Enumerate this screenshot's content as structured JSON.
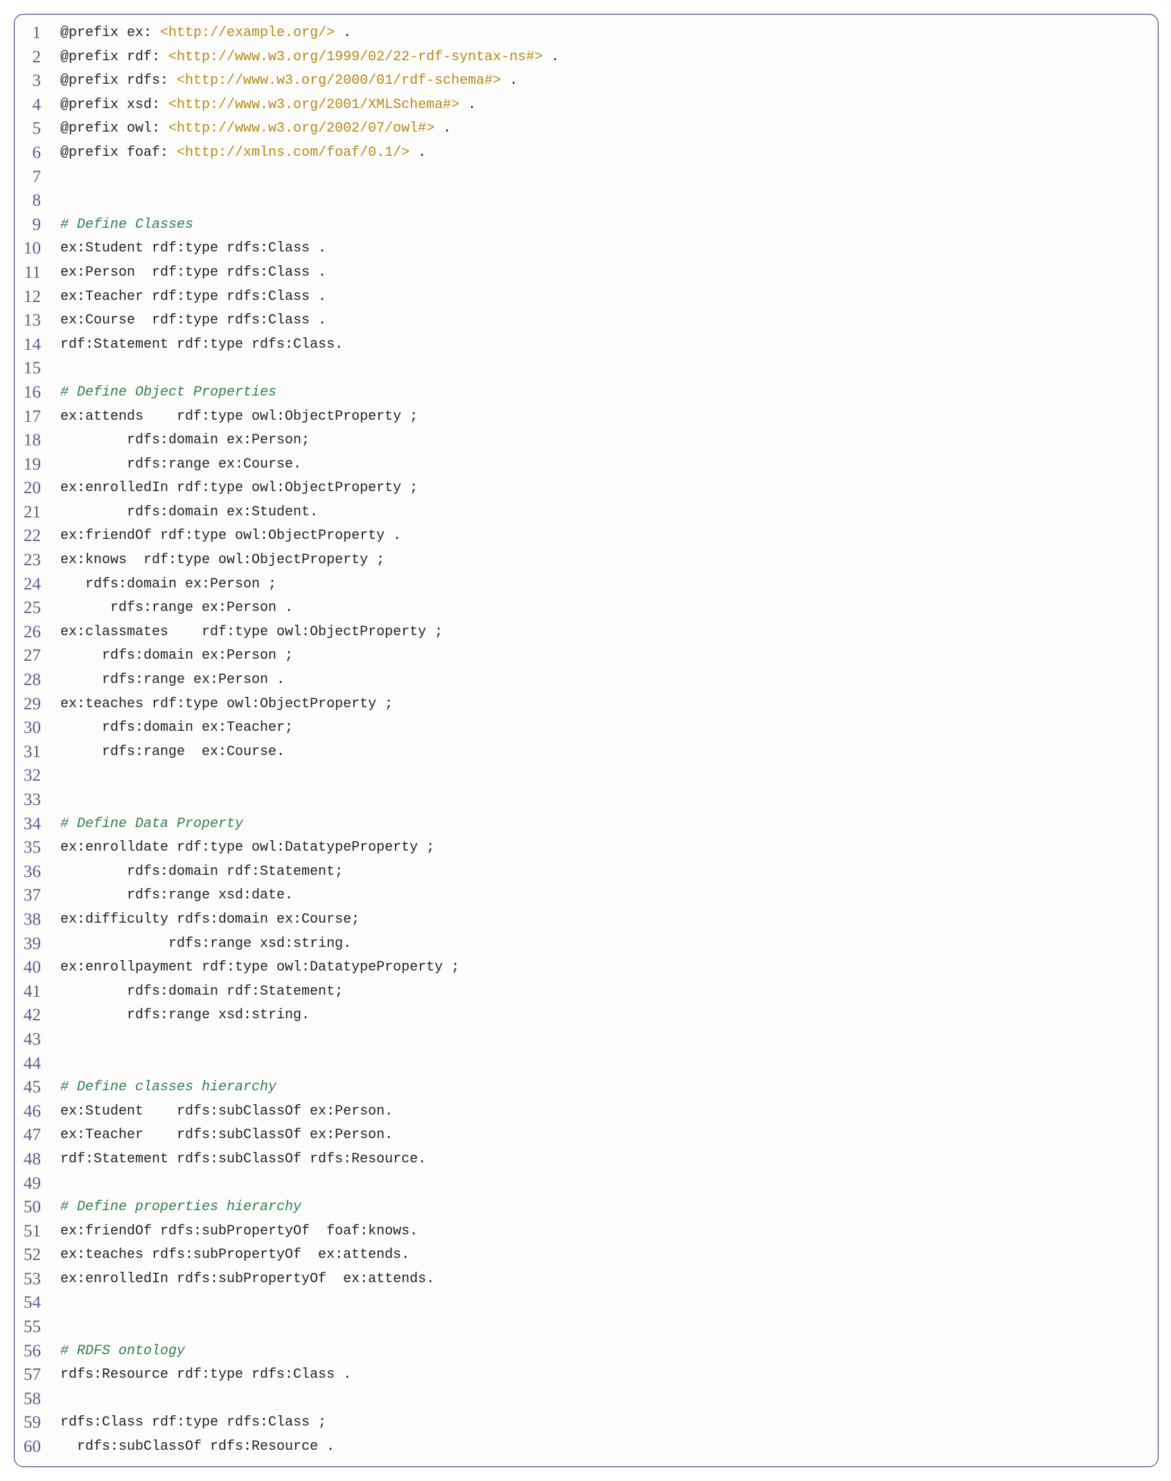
{
  "lines": [
    {
      "num": 1,
      "segs": [
        {
          "t": "@prefix ex: "
        },
        {
          "t": "<http://example.org/>",
          "c": "str"
        },
        {
          "t": " ."
        }
      ]
    },
    {
      "num": 2,
      "segs": [
        {
          "t": "@prefix rdf: "
        },
        {
          "t": "<http://www.w3.org/1999/02/22-rdf-syntax-ns#>",
          "c": "str"
        },
        {
          "t": " ."
        }
      ]
    },
    {
      "num": 3,
      "segs": [
        {
          "t": "@prefix rdfs: "
        },
        {
          "t": "<http://www.w3.org/2000/01/rdf-schema#>",
          "c": "str"
        },
        {
          "t": " ."
        }
      ]
    },
    {
      "num": 4,
      "segs": [
        {
          "t": "@prefix xsd: "
        },
        {
          "t": "<http://www.w3.org/2001/XMLSchema#>",
          "c": "str"
        },
        {
          "t": " ."
        }
      ]
    },
    {
      "num": 5,
      "segs": [
        {
          "t": "@prefix owl: "
        },
        {
          "t": "<http://www.w3.org/2002/07/owl#>",
          "c": "str"
        },
        {
          "t": " ."
        }
      ]
    },
    {
      "num": 6,
      "segs": [
        {
          "t": "@prefix foaf: "
        },
        {
          "t": "<http://xmlns.com/foaf/0.1/>",
          "c": "str"
        },
        {
          "t": " ."
        }
      ]
    },
    {
      "num": 7,
      "segs": [
        {
          "t": ""
        }
      ]
    },
    {
      "num": 8,
      "segs": [
        {
          "t": ""
        }
      ]
    },
    {
      "num": 9,
      "segs": [
        {
          "t": "# Define Classes",
          "c": "com"
        }
      ]
    },
    {
      "num": 10,
      "segs": [
        {
          "t": "ex:Student rdf:type rdfs:Class ."
        }
      ]
    },
    {
      "num": 11,
      "segs": [
        {
          "t": "ex:Person  rdf:type rdfs:Class ."
        }
      ]
    },
    {
      "num": 12,
      "segs": [
        {
          "t": "ex:Teacher rdf:type rdfs:Class ."
        }
      ]
    },
    {
      "num": 13,
      "segs": [
        {
          "t": "ex:Course  rdf:type rdfs:Class ."
        }
      ]
    },
    {
      "num": 14,
      "segs": [
        {
          "t": "rdf:Statement rdf:type rdfs:Class."
        }
      ]
    },
    {
      "num": 15,
      "segs": [
        {
          "t": ""
        }
      ]
    },
    {
      "num": 16,
      "segs": [
        {
          "t": "# Define Object Properties",
          "c": "com"
        }
      ]
    },
    {
      "num": 17,
      "segs": [
        {
          "t": "ex:attends    rdf:type owl:ObjectProperty ;"
        }
      ]
    },
    {
      "num": 18,
      "segs": [
        {
          "t": "        rdfs:domain ex:Person;"
        }
      ]
    },
    {
      "num": 19,
      "segs": [
        {
          "t": "        rdfs:range ex:Course."
        }
      ]
    },
    {
      "num": 20,
      "segs": [
        {
          "t": "ex:enrolledIn rdf:type owl:ObjectProperty ;"
        }
      ]
    },
    {
      "num": 21,
      "segs": [
        {
          "t": "        rdfs:domain ex:Student."
        }
      ]
    },
    {
      "num": 22,
      "segs": [
        {
          "t": "ex:friendOf rdf:type owl:ObjectProperty ."
        }
      ]
    },
    {
      "num": 23,
      "segs": [
        {
          "t": "ex:knows  rdf:type owl:ObjectProperty ;"
        }
      ]
    },
    {
      "num": 24,
      "segs": [
        {
          "t": "   rdfs:domain ex:Person ;"
        }
      ]
    },
    {
      "num": 25,
      "segs": [
        {
          "t": "      rdfs:range ex:Person ."
        }
      ]
    },
    {
      "num": 26,
      "segs": [
        {
          "t": "ex:classmates    rdf:type owl:ObjectProperty ;"
        }
      ]
    },
    {
      "num": 27,
      "segs": [
        {
          "t": "     rdfs:domain ex:Person ;"
        }
      ]
    },
    {
      "num": 28,
      "segs": [
        {
          "t": "     rdfs:range ex:Person ."
        }
      ]
    },
    {
      "num": 29,
      "segs": [
        {
          "t": "ex:teaches rdf:type owl:ObjectProperty ;"
        }
      ]
    },
    {
      "num": 30,
      "segs": [
        {
          "t": "     rdfs:domain ex:Teacher;"
        }
      ]
    },
    {
      "num": 31,
      "segs": [
        {
          "t": "     rdfs:range  ex:Course."
        }
      ]
    },
    {
      "num": 32,
      "segs": [
        {
          "t": ""
        }
      ]
    },
    {
      "num": 33,
      "segs": [
        {
          "t": ""
        }
      ]
    },
    {
      "num": 34,
      "segs": [
        {
          "t": "# Define Data Property",
          "c": "com"
        }
      ]
    },
    {
      "num": 35,
      "segs": [
        {
          "t": "ex:enrolldate rdf:type owl:DatatypeProperty ;"
        }
      ]
    },
    {
      "num": 36,
      "segs": [
        {
          "t": "        rdfs:domain rdf:Statement;"
        }
      ]
    },
    {
      "num": 37,
      "segs": [
        {
          "t": "        rdfs:range xsd:date."
        }
      ]
    },
    {
      "num": 38,
      "segs": [
        {
          "t": "ex:difficulty rdfs:domain ex:Course;"
        }
      ]
    },
    {
      "num": 39,
      "segs": [
        {
          "t": "             rdfs:range xsd:string."
        }
      ]
    },
    {
      "num": 40,
      "segs": [
        {
          "t": "ex:enrollpayment rdf:type owl:DatatypeProperty ;"
        }
      ]
    },
    {
      "num": 41,
      "segs": [
        {
          "t": "        rdfs:domain rdf:Statement;"
        }
      ]
    },
    {
      "num": 42,
      "segs": [
        {
          "t": "        rdfs:range xsd:string."
        }
      ]
    },
    {
      "num": 43,
      "segs": [
        {
          "t": ""
        }
      ]
    },
    {
      "num": 44,
      "segs": [
        {
          "t": ""
        }
      ]
    },
    {
      "num": 45,
      "segs": [
        {
          "t": "# Define classes hierarchy",
          "c": "com"
        }
      ]
    },
    {
      "num": 46,
      "segs": [
        {
          "t": "ex:Student    rdfs:subClassOf ex:Person."
        }
      ]
    },
    {
      "num": 47,
      "segs": [
        {
          "t": "ex:Teacher    rdfs:subClassOf ex:Person."
        }
      ]
    },
    {
      "num": 48,
      "segs": [
        {
          "t": "rdf:Statement rdfs:subClassOf rdfs:Resource."
        }
      ]
    },
    {
      "num": 49,
      "segs": [
        {
          "t": ""
        }
      ]
    },
    {
      "num": 50,
      "segs": [
        {
          "t": "# Define properties hierarchy",
          "c": "com"
        }
      ]
    },
    {
      "num": 51,
      "segs": [
        {
          "t": "ex:friendOf rdfs:subPropertyOf  foaf:knows."
        }
      ]
    },
    {
      "num": 52,
      "segs": [
        {
          "t": "ex:teaches rdfs:subPropertyOf  ex:attends."
        }
      ]
    },
    {
      "num": 53,
      "segs": [
        {
          "t": "ex:enrolledIn rdfs:subPropertyOf  ex:attends."
        }
      ]
    },
    {
      "num": 54,
      "segs": [
        {
          "t": ""
        }
      ]
    },
    {
      "num": 55,
      "segs": [
        {
          "t": ""
        }
      ]
    },
    {
      "num": 56,
      "segs": [
        {
          "t": "# RDFS ontology",
          "c": "com"
        }
      ]
    },
    {
      "num": 57,
      "segs": [
        {
          "t": "rdfs:Resource rdf:type rdfs:Class ."
        }
      ]
    },
    {
      "num": 58,
      "segs": [
        {
          "t": ""
        }
      ]
    },
    {
      "num": 59,
      "segs": [
        {
          "t": "rdfs:Class rdf:type rdfs:Class ;"
        }
      ]
    },
    {
      "num": 60,
      "segs": [
        {
          "t": "  rdfs:subClassOf rdfs:Resource ."
        }
      ]
    }
  ]
}
